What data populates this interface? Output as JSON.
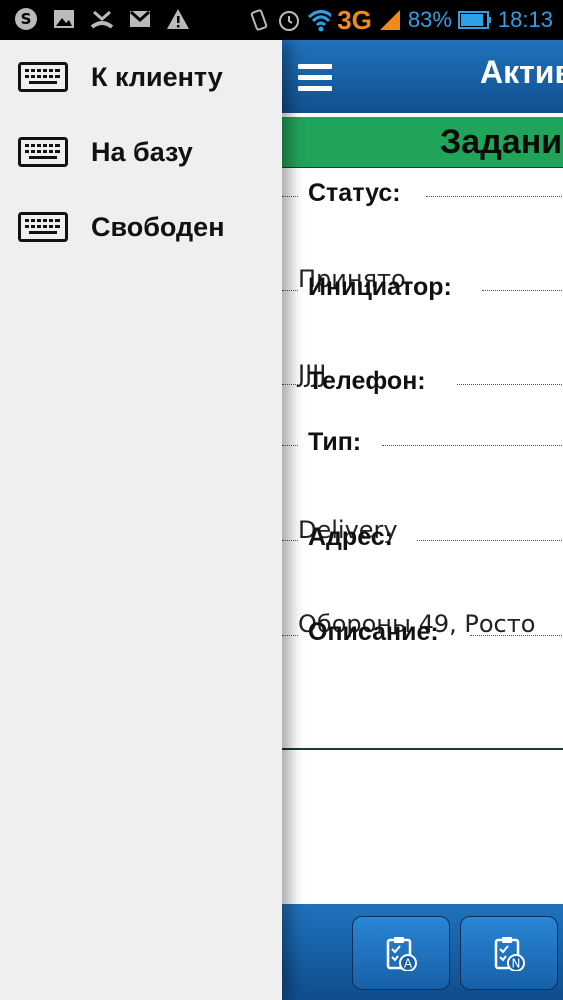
{
  "status_bar": {
    "network": "3G",
    "battery": "83%",
    "time": "18:13",
    "icons": [
      "skype-icon",
      "image-icon",
      "missed-call-icon",
      "gmail-icon",
      "warning-icon",
      "vibrate-icon",
      "alarm-icon",
      "wifi-icon",
      "signal-icon",
      "battery-icon"
    ]
  },
  "drawer": {
    "items": [
      {
        "label": "К клиенту",
        "icon": "keyboard-icon"
      },
      {
        "label": "На базу",
        "icon": "keyboard-icon"
      },
      {
        "label": "Свободен",
        "icon": "keyboard-icon"
      }
    ]
  },
  "app_bar": {
    "title": "Актив",
    "menu_icon": "hamburger-icon"
  },
  "task": {
    "section_title": "Задани",
    "fields": [
      {
        "label": "Статус:",
        "value": "Принято"
      },
      {
        "label": "Инициатор:",
        "value": "JJJJ"
      },
      {
        "label": "Телефон:",
        "value": ""
      },
      {
        "label": "Тип:",
        "value": "Delivery"
      },
      {
        "label": "Адрес:",
        "value": "Обороны 49, Росто"
      },
      {
        "label": "Описание:",
        "value": ""
      }
    ]
  },
  "bottom_bar": {
    "buttons": [
      {
        "icon": "clipboard-a-icon",
        "glyph": "A"
      },
      {
        "icon": "clipboard-n-icon",
        "glyph": "N"
      }
    ]
  },
  "colors": {
    "accent_blue": "#1a66b0",
    "section_green": "#1fa45a",
    "status_blue": "#2ea0e6",
    "network_orange": "#f08a1a"
  }
}
